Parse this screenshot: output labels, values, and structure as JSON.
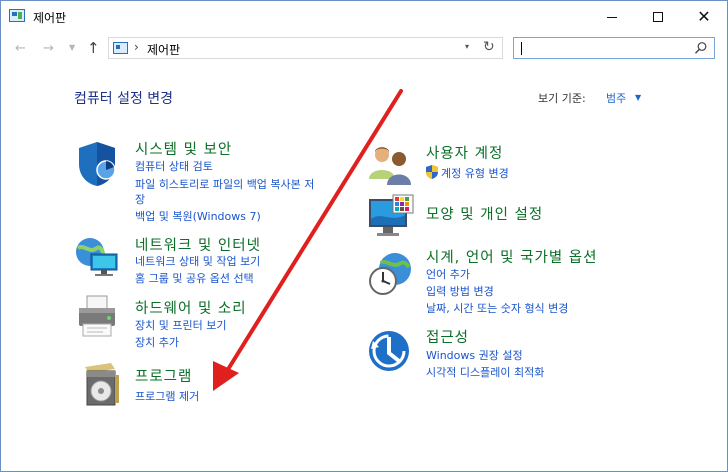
{
  "window": {
    "title": "제어판",
    "controls": {
      "minimize": "—",
      "maximize": "☐",
      "close": "✕"
    }
  },
  "nav": {
    "back_icon": "arrow-left-icon",
    "forward_icon": "arrow-right-icon",
    "recent_icon": "chevron-down-icon",
    "up_icon": "arrow-up-icon",
    "address_separator": "›",
    "address_path": "제어판",
    "refresh_icon": "refresh-icon",
    "search_value": ""
  },
  "main": {
    "title": "컴퓨터 설정 변경",
    "view_by": {
      "label": "보기 기준:",
      "value": "범주"
    }
  },
  "categories": [
    {
      "title": "시스템 및 보안",
      "icon": "shield-icon",
      "links": [
        "컴퓨터 상태 검토",
        "파일 히스토리로 파일의 백업 복사본 저",
        "장",
        "백업 및 복원(Windows 7)"
      ]
    },
    {
      "title": "네트워크 및 인터넷",
      "icon": "network-globe-icon",
      "links": [
        "네트워크 상태 및 작업 보기",
        "홈 그룹 및 공유 옵션 선택"
      ]
    },
    {
      "title": "하드웨어 및 소리",
      "icon": "printer-icon",
      "links": [
        "장치 및 프린터 보기",
        "장치 추가"
      ]
    },
    {
      "title": "프로그램",
      "icon": "program-disc-icon",
      "links": [
        "프로그램 제거"
      ]
    },
    {
      "title": "사용자 계정",
      "icon": "users-icon",
      "links": [
        "계정 유형 변경"
      ]
    },
    {
      "title": "모양 및 개인 설정",
      "icon": "monitor-icon",
      "links": []
    },
    {
      "title": "시계, 언어 및 국가별 옵션",
      "icon": "clock-globe-icon",
      "links": [
        "언어 추가",
        "입력 방법 변경",
        "날짜, 시간 또는 숫자 형식 변경"
      ]
    },
    {
      "title": "접근성",
      "icon": "accessibility-icon",
      "links": [
        "Windows 권장 설정",
        "시각적 디스플레이 최적화"
      ]
    }
  ],
  "colors": {
    "category_title": "#0b6f27",
    "link": "#1a55cc",
    "heading": "#1e3287",
    "annotation_arrow": "#e0201e"
  }
}
